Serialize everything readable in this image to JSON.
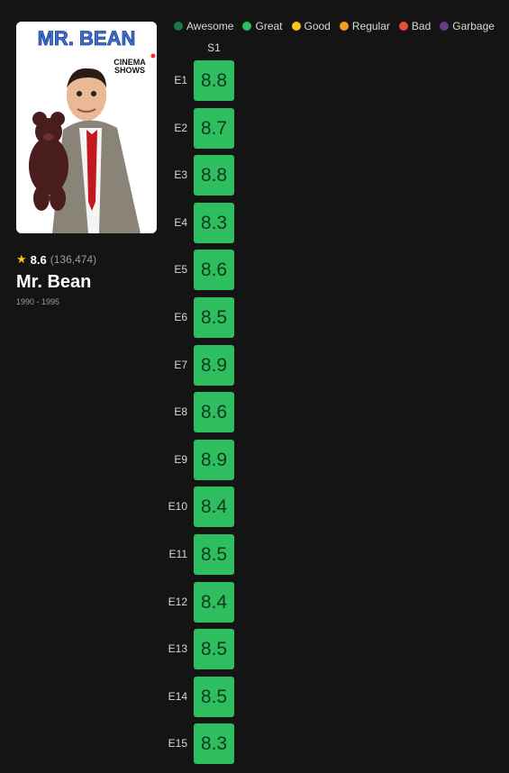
{
  "show": {
    "rating": "8.6",
    "votes": "(136,474)",
    "title": "Mr. Bean",
    "years": "1990 - 1995",
    "poster": {
      "title": "MR. BEAN",
      "tag_line1": "CINEMA",
      "tag_line2": "SHOWS"
    }
  },
  "legend": [
    {
      "label": "Awesome",
      "color": "#1e7a44"
    },
    {
      "label": "Great",
      "color": "#2ebd5f"
    },
    {
      "label": "Good",
      "color": "#f5c518"
    },
    {
      "label": "Regular",
      "color": "#f39c1f"
    },
    {
      "label": "Bad",
      "color": "#e74c3c"
    },
    {
      "label": "Garbage",
      "color": "#6c3a8a"
    }
  ],
  "season_header": "S1",
  "episodes": [
    {
      "label": "E1",
      "rating": "8.8"
    },
    {
      "label": "E2",
      "rating": "8.7"
    },
    {
      "label": "E3",
      "rating": "8.8"
    },
    {
      "label": "E4",
      "rating": "8.3"
    },
    {
      "label": "E5",
      "rating": "8.6"
    },
    {
      "label": "E6",
      "rating": "8.5"
    },
    {
      "label": "E7",
      "rating": "8.9"
    },
    {
      "label": "E8",
      "rating": "8.6"
    },
    {
      "label": "E9",
      "rating": "8.9"
    },
    {
      "label": "E10",
      "rating": "8.4"
    },
    {
      "label": "E11",
      "rating": "8.5"
    },
    {
      "label": "E12",
      "rating": "8.4"
    },
    {
      "label": "E13",
      "rating": "8.5"
    },
    {
      "label": "E14",
      "rating": "8.5"
    },
    {
      "label": "E15",
      "rating": "8.3"
    }
  ],
  "cell_color": "#2ebd5f",
  "icons": {
    "rating": "star-icon"
  }
}
